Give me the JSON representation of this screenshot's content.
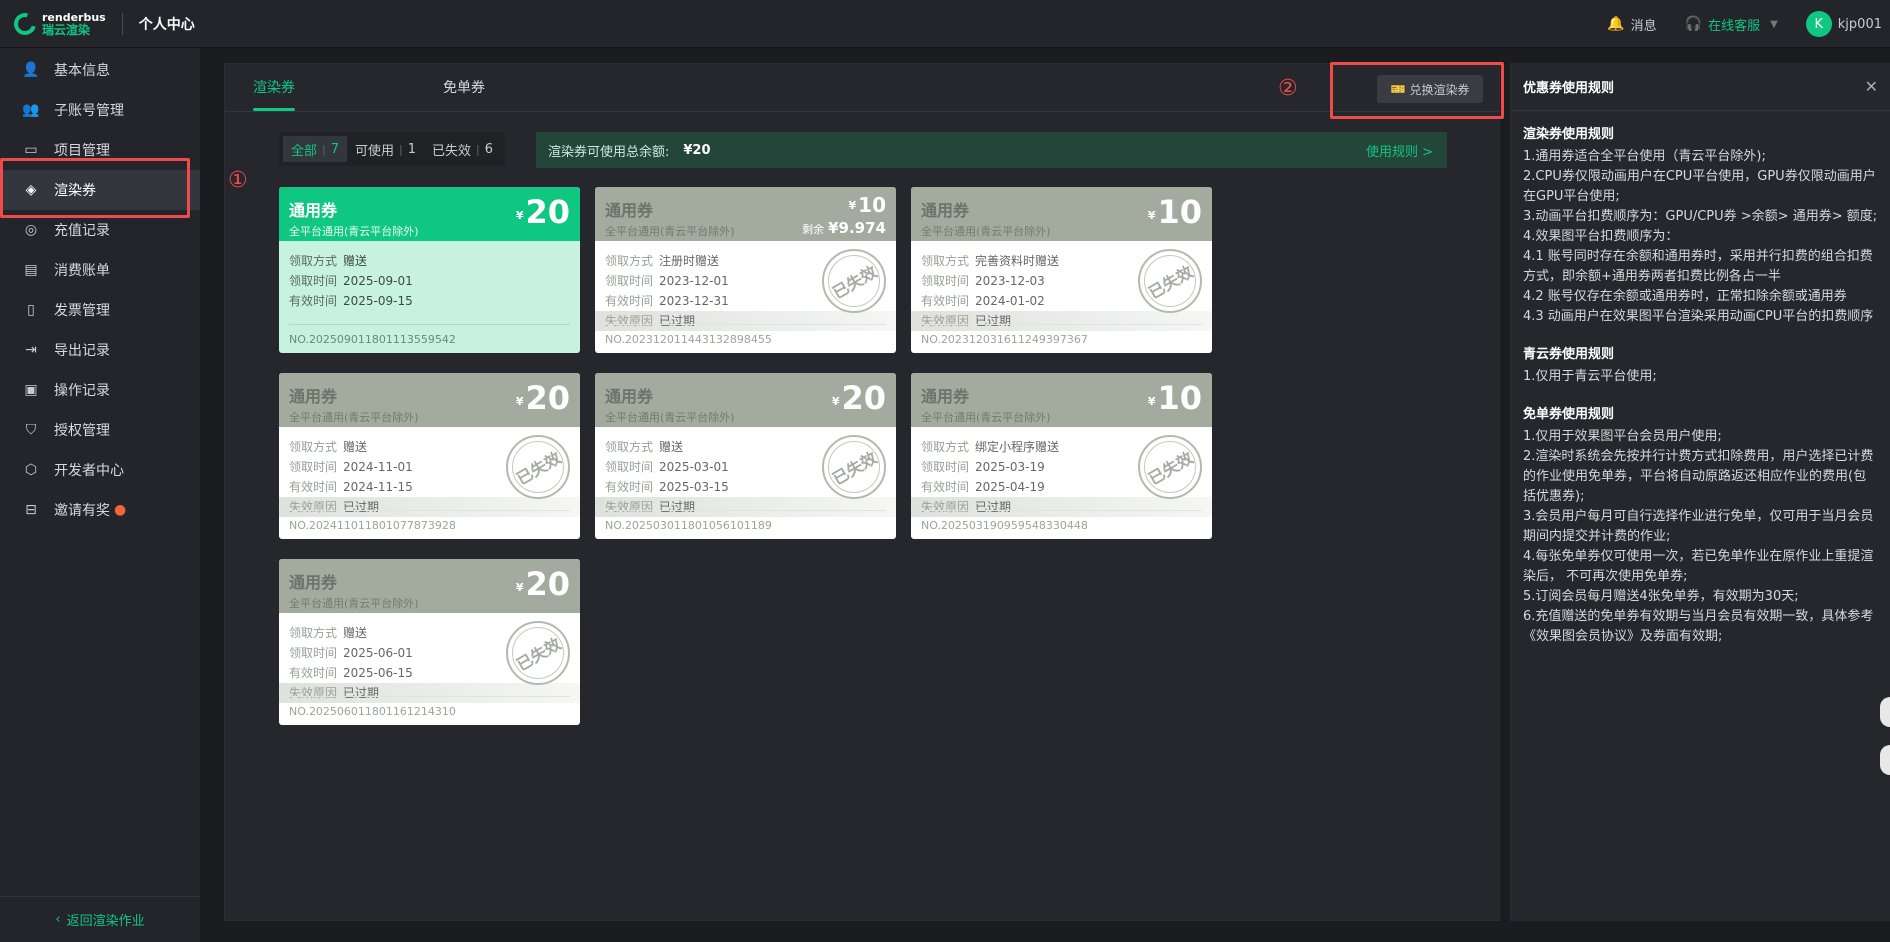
{
  "app": {
    "logo_en": "renderbus",
    "logo_cn": "瑞云渲染",
    "title": "个人中心"
  },
  "topbar": {
    "messages": "消息",
    "support": "在线客服",
    "avatar_letter": "K",
    "username": "kjp001"
  },
  "sidebar": {
    "items": [
      {
        "label": "基本信息",
        "icon": "user-icon"
      },
      {
        "label": "子账号管理",
        "icon": "users-icon"
      },
      {
        "label": "项目管理",
        "icon": "folder-icon"
      },
      {
        "label": "渲染券",
        "icon": "ticket-icon"
      },
      {
        "label": "充值记录",
        "icon": "recharge-icon"
      },
      {
        "label": "消费账单",
        "icon": "bill-icon"
      },
      {
        "label": "发票管理",
        "icon": "invoice-icon"
      },
      {
        "label": "导出记录",
        "icon": "export-icon"
      },
      {
        "label": "操作记录",
        "icon": "log-icon"
      },
      {
        "label": "授权管理",
        "icon": "shield-icon"
      },
      {
        "label": "开发者中心",
        "icon": "cube-icon"
      },
      {
        "label": "邀请有奖",
        "icon": "gift-icon"
      }
    ],
    "back": "返回渲染作业"
  },
  "main": {
    "tabs": [
      "渲染券",
      "免单券"
    ],
    "exchange_button": "兑换渲染券",
    "annotation_1": "①",
    "annotation_2": "②",
    "filters": [
      {
        "label": "全部",
        "count": "7"
      },
      {
        "label": "可使用",
        "count": "1"
      },
      {
        "label": "已失效",
        "count": "6"
      }
    ],
    "balance_label": "渲染券可使用总余额:",
    "balance_value": "¥20",
    "rules_link": "使用规则 >"
  },
  "card_labels": {
    "method": "领取方式",
    "received": "领取时间",
    "expires": "有效时间",
    "reason": "失效原因",
    "stamp": "已失效",
    "currency": "¥",
    "remaining": "剩余"
  },
  "cards": [
    {
      "type": "通用券",
      "scope": "全平台通用(青云平台除外)",
      "amount": "20",
      "method": "赠送",
      "received": "2025-09-01",
      "expires": "2025-09-15",
      "reason": "",
      "no": "NO.20250901180111355954​2",
      "valid": true
    },
    {
      "type": "通用券",
      "scope": "全平台通用(青云平台除外)",
      "amount": "10",
      "remaining": "¥9.974",
      "method": "注册时赠送",
      "received": "2023-12-01",
      "expires": "2023-12-31",
      "reason": "已过期",
      "no": "NO.202312011443132898455",
      "valid": false
    },
    {
      "type": "通用券",
      "scope": "全平台通用(青云平台除外)",
      "amount": "10",
      "method": "完善资料时赠送",
      "received": "2023-12-03",
      "expires": "2024-01-02",
      "reason": "已过期",
      "no": "NO.20231203161124939736​7",
      "valid": false
    },
    {
      "type": "通用券",
      "scope": "全平台通用(青云平台除外)",
      "amount": "20",
      "method": "赠送",
      "received": "2024-11-01",
      "expires": "2024-11-15",
      "reason": "已过期",
      "no": "NO.202411011801077873928",
      "valid": false
    },
    {
      "type": "通用券",
      "scope": "全平台通用(青云平台除外)",
      "amount": "20",
      "method": "赠送",
      "received": "2025-03-01",
      "expires": "2025-03-15",
      "reason": "已过期",
      "no": "NO.202503011801056101189",
      "valid": false
    },
    {
      "type": "通用券",
      "scope": "全平台通用(青云平台除外)",
      "amount": "10",
      "method": "绑定小程序赠送",
      "received": "2025-03-19",
      "expires": "2025-04-19",
      "reason": "已过期",
      "no": "NO.202503190959548330448",
      "valid": false
    },
    {
      "type": "通用券",
      "scope": "全平台通用(青云平台除外)",
      "amount": "20",
      "method": "赠送",
      "received": "2025-06-01",
      "expires": "2025-06-15",
      "reason": "已过期",
      "no": "NO.202506011801161214310",
      "valid": false
    }
  ],
  "panel": {
    "title": "优惠券使用规则",
    "sections": [
      {
        "heading": "渲染券使用规则",
        "lines": [
          "1.通用券适合全平台使用（青云平台除外);",
          "2.CPU券仅限动画用户在CPU平台使用，GPU券仅限动画用户在GPU平台使用;",
          "3.动画平台扣费顺序为：GPU/CPU券 >余额> 通用券> 额度;",
          "4.效果图平台扣费顺序为：",
          "4.1 账号同时存在余额和通用券时，采用并行扣费的组合扣费方式，即余额+通用券两者扣费比例各占一半",
          "4.2 账号仅存在余额或通用券时，正常扣除余额或通用券",
          "4.3 动画用户在效果图平台渲染采用动画CPU平台的扣费顺序"
        ]
      },
      {
        "heading": "青云券使用规则",
        "lines": [
          "1.仅用于青云平台使用;"
        ]
      },
      {
        "heading": "免单券使用规则",
        "lines": [
          "1.仅用于效果图平台会员用户使用;",
          "2.渲染时系统会先按并行计费方式扣除费用，用户选择已计费的作业使用免单券，平台将自动原路返还相应作业的费用(包括优惠券);",
          "3.会员用户每月可自行选择作业进行免单，仅可用于当月会员期间内提交并计费的作业;",
          "4.每张免单券仅可使用一次，若已免单作业在原作业上重提渲染后，  不可再次使用免单券;",
          "5.订阅会员每月赠送4张免单券，有效期为30天;",
          "6.充值赠送的免单券有效期与当月会员有效期一致，具体参考《效果图会员协议》及券面有效期;"
        ]
      }
    ]
  }
}
